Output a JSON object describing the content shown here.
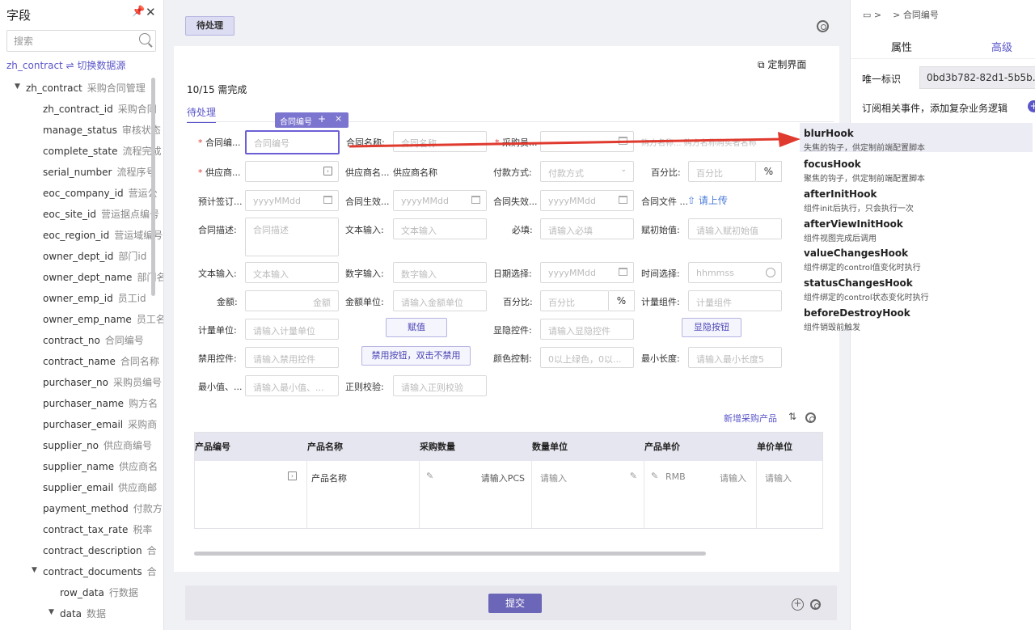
{
  "left": {
    "title": "字段",
    "search_placeholder": "搜索",
    "datasource": "zh_contract ⇌ 切换数据源",
    "tree": [
      {
        "en": "zh_contract",
        "cn": "采购合同管理"
      },
      {
        "en": "zh_contract_id",
        "cn": "采购合同"
      },
      {
        "en": "manage_status",
        "cn": "审核状态"
      },
      {
        "en": "complete_state",
        "cn": "流程完成"
      },
      {
        "en": "serial_number",
        "cn": "流程序号"
      },
      {
        "en": "eoc_company_id",
        "cn": "营运公"
      },
      {
        "en": "eoc_site_id",
        "cn": "营运据点编号"
      },
      {
        "en": "eoc_region_id",
        "cn": "营运域编号"
      },
      {
        "en": "owner_dept_id",
        "cn": "部门id"
      },
      {
        "en": "owner_dept_name",
        "cn": "部门名"
      },
      {
        "en": "owner_emp_id",
        "cn": "员工id"
      },
      {
        "en": "owner_emp_name",
        "cn": "员工名"
      },
      {
        "en": "contract_no",
        "cn": "合同编号"
      },
      {
        "en": "contract_name",
        "cn": "合同名称"
      },
      {
        "en": "purchaser_no",
        "cn": "采购员编号"
      },
      {
        "en": "purchaser_name",
        "cn": "购方名"
      },
      {
        "en": "purchaser_email",
        "cn": "采购商"
      },
      {
        "en": "supplier_no",
        "cn": "供应商编号"
      },
      {
        "en": "supplier_name",
        "cn": "供应商名"
      },
      {
        "en": "supplier_email",
        "cn": "供应商邮"
      },
      {
        "en": "payment_method",
        "cn": "付款方"
      },
      {
        "en": "contract_tax_rate",
        "cn": "税率"
      },
      {
        "en": "contract_description",
        "cn": "合"
      },
      {
        "en": "contract_documents",
        "cn": "合"
      },
      {
        "en": "row_data",
        "cn": "行数据"
      },
      {
        "en": "data",
        "cn": "数据"
      }
    ]
  },
  "mid": {
    "tab": "待处理",
    "custom_label": "定制界面",
    "progress": "10/15 需完成",
    "section": "待处理",
    "mini_tag": "合同编号",
    "mini_add": "+",
    "mini_close": "×",
    "labels": {
      "contract_no": "合同编...",
      "contract_name": "合同名称:",
      "purchaser": "采购员...",
      "hidden_text": "购方名称... 购方名称购买者名称",
      "supplier": "供应商...",
      "supplier_name": "供应商名...",
      "supplier_name_val": "供应商名称",
      "payment": "付款方式:",
      "percent": "百分比:",
      "sign": "预计签订...",
      "effective": "合同生效...",
      "expire": "合同失效...",
      "contract_file": "合同文件 ...",
      "upload": "请上传",
      "desc": "合同描述:",
      "text_input": "文本输入:",
      "required": "必填:",
      "init_val": "赋初始值:",
      "text_input2": "文本输入:",
      "num_input": "数字输入:",
      "date_select": "日期选择:",
      "time_select": "时间选择:",
      "amount": "金额:",
      "amount_unit": "金额单位:",
      "percent2": "百分比:",
      "measure": "计量组件:",
      "measure_unit": "计量单位:",
      "show_hide": "显隐控件:",
      "disable": "禁用控件:",
      "color_ctrl": "颜色控制:",
      "min_len": "最小长度:",
      "min_val": "最小值、...",
      "regex": "正则校验:"
    },
    "placeholders": {
      "contract_no": "合同编号",
      "contract_name": "合同名称",
      "payment": "付款方式",
      "percent": "百分比",
      "date": "yyyyMMdd",
      "desc": "合同描述",
      "text_input": "文本输入",
      "required": "请输入必填",
      "init_val": "请输入赋初始值",
      "num_input": "数字输入",
      "time": "hhmmss",
      "amount": "金额",
      "amount_unit": "请输入金额单位",
      "measure": "计量组件",
      "measure_unit": "请输入计量单位",
      "show_hide": "请输入显隐控件",
      "disable": "请输入禁用控件",
      "color_ctrl": "0以上绿色，0以...",
      "min_len": "请输入最小长度5",
      "min_val": "请输入最小值、...",
      "regex": "请输入正则校验"
    },
    "buttons": {
      "assign": "赋值",
      "show_btn": "显隐按钮",
      "disable_btn": "禁用按钮，双击不禁用"
    },
    "percent_sign": "%",
    "table_add": "新增采购产品",
    "table_headers": [
      "产品编号",
      "产品名称",
      "采购数量",
      "数量单位",
      "产品单价",
      "单价单位"
    ],
    "table_row": {
      "product_name": "产品名称",
      "qty": "请输入PCS",
      "unit": "请输入",
      "rmb": "RMB",
      "price": "请输入",
      "price_unit": "请输入"
    },
    "submit": "提交"
  },
  "right": {
    "crumb_sep": ">",
    "crumb_item": "合同编号",
    "tab_props": "属性",
    "tab_adv": "高级",
    "uid_label": "唯一标识",
    "uid_value": "0bd3b782-82d1-5b5b...",
    "subscribe": "订阅相关事件，添加复杂业务逻辑"
  },
  "hooks": [
    {
      "name": "blurHook",
      "desc": "失焦的钩子，供定制前端配置脚本"
    },
    {
      "name": "focusHook",
      "desc": "聚焦的钩子，供定制前端配置脚本"
    },
    {
      "name": "afterInitHook",
      "desc": "组件init后执行，只会执行一次"
    },
    {
      "name": "afterViewInitHook",
      "desc": "组件视图完成后调用"
    },
    {
      "name": "valueChangesHook",
      "desc": "组件绑定的control值变化时执行"
    },
    {
      "name": "statusChangesHook",
      "desc": "组件绑定的control状态变化时执行"
    },
    {
      "name": "beforeDestroyHook",
      "desc": "组件销毁前触发"
    }
  ],
  "colors": {
    "accent": "#5b57c9",
    "arrow": "#e03a2f"
  }
}
